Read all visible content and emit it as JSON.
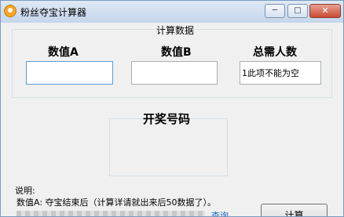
{
  "window": {
    "title": "粉丝夺宝计算器"
  },
  "title_buttons": {
    "minimize": "─",
    "maximize": "□",
    "close": "✕"
  },
  "group": {
    "title": "计算数据"
  },
  "fields": {
    "a": {
      "label": "数值A",
      "value": ""
    },
    "b": {
      "label": "数值B",
      "value": ""
    },
    "c": {
      "label": "总需人数",
      "value": "1此项不能为空"
    }
  },
  "winning": {
    "label": "开奖号码"
  },
  "notes": {
    "title": "说明:",
    "line1": "数值A: 夺宝结束后（计算详请就出来后50数据了）。",
    "link": "查询"
  },
  "buttons": {
    "calculate": "计算"
  },
  "icons": {
    "app": "app-logo-icon"
  }
}
